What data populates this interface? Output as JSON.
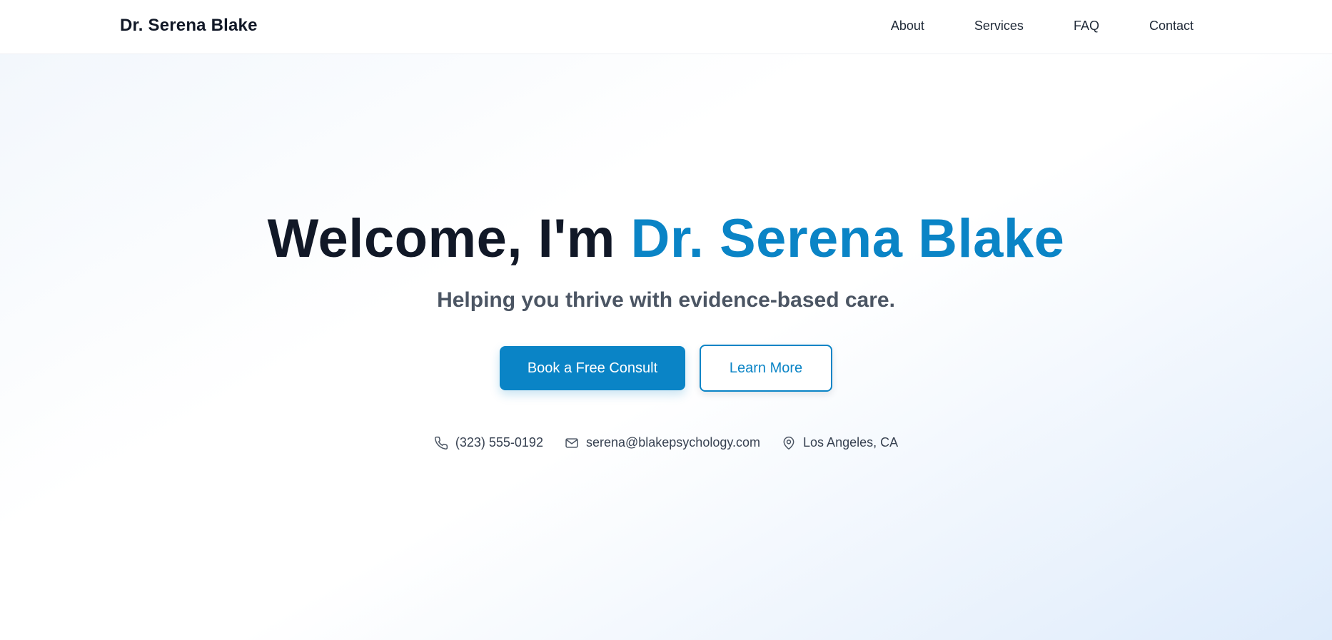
{
  "header": {
    "brand": "Dr. Serena Blake",
    "nav": [
      {
        "label": "About"
      },
      {
        "label": "Services"
      },
      {
        "label": "FAQ"
      },
      {
        "label": "Contact"
      }
    ]
  },
  "hero": {
    "title_prefix": "Welcome, I'm ",
    "title_name": "Dr. Serena Blake",
    "subtitle": "Helping you thrive with evidence-based care.",
    "primary_button": "Book a Free Consult",
    "secondary_button": "Learn More"
  },
  "contact": {
    "phone": "(323) 555-0192",
    "email": "serena@blakepsychology.com",
    "location": "Los Angeles, CA",
    "icons": [
      "phone-icon",
      "mail-icon",
      "map-pin-icon"
    ]
  },
  "colors": {
    "accent": "#0a84c6",
    "heading": "#111827",
    "subtitle": "#4b5563"
  }
}
